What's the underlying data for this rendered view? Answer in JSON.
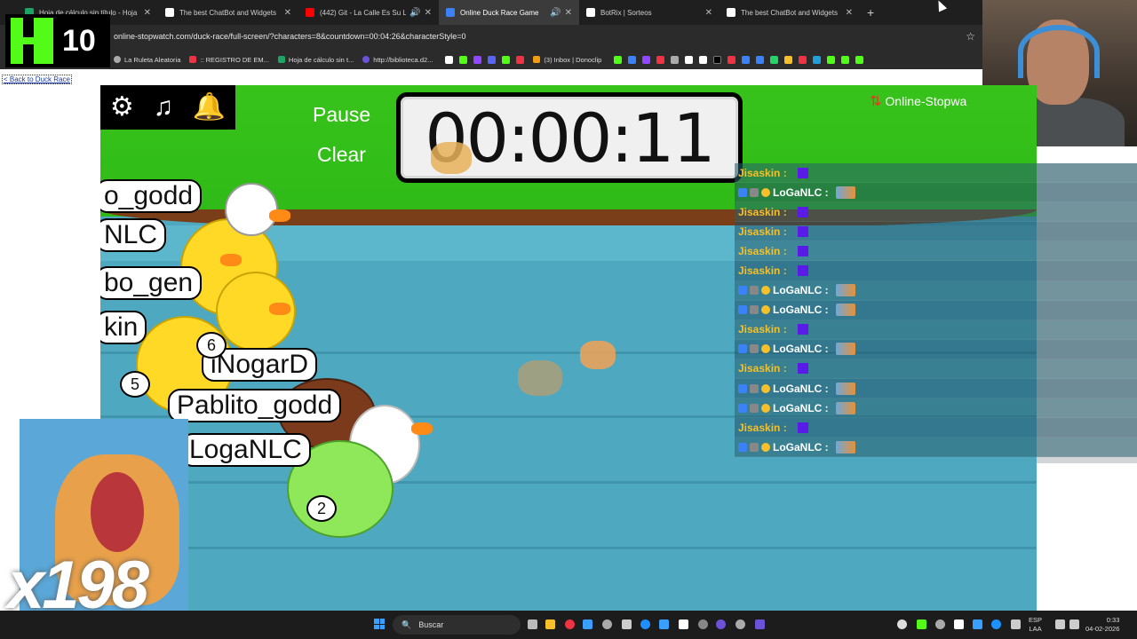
{
  "browser": {
    "tabs": [
      {
        "title": "Hoja de cálculo sin título - Hoja",
        "color": "#1ea362"
      },
      {
        "title": "The best ChatBot and Widgets",
        "color": "#ffffff"
      },
      {
        "title": "(442) Git - La Calle Es Su Lu",
        "color": "#ff0000"
      },
      {
        "title": "Online Duck Race Game",
        "color": "#3b82f6"
      },
      {
        "title": "BotRix | Sorteos",
        "color": "#ffffff"
      },
      {
        "title": "The best ChatBot and Widgets",
        "color": "#ffffff"
      }
    ],
    "active_tab": 3,
    "url": "online-stopwatch.com/duck-race/full-screen/?characters=8&countdown=00:04:26&characterStyle=0",
    "bookmarks": [
      "La Ruleta Aleatoria",
      ":: REGISTRO DE EM...",
      "Hoja de cálculo sin t...",
      "http://biblioteca.d2...",
      "(3) Inbox | Donoclip"
    ]
  },
  "overlay": {
    "kick_count": "10",
    "gift_multiplier": "x198"
  },
  "page": {
    "back_link": "< Back to Duck Race",
    "pause_label": "Pause",
    "clear_label": "Clear",
    "timer": "00:00:11",
    "brand": "Online-Stopwa"
  },
  "racers": {
    "names": [
      "o_godd",
      "NLC",
      "bo_gen",
      "kin",
      "iNogarD",
      "Pablito_godd",
      "LogaNLC"
    ],
    "numbers": [
      "5",
      "6",
      "2"
    ]
  },
  "chat": {
    "messages": [
      {
        "user": "Jisaskin :",
        "type": "j"
      },
      {
        "user": "LoGaNLC :",
        "type": "l"
      },
      {
        "user": "Jisaskin :",
        "type": "j"
      },
      {
        "user": "Jisaskin :",
        "type": "j"
      },
      {
        "user": "Jisaskin :",
        "type": "j"
      },
      {
        "user": "Jisaskin :",
        "type": "j"
      },
      {
        "user": "LoGaNLC :",
        "type": "l"
      },
      {
        "user": "LoGaNLC :",
        "type": "l"
      },
      {
        "user": "Jisaskin :",
        "type": "j"
      },
      {
        "user": "LoGaNLC :",
        "type": "l"
      },
      {
        "user": "Jisaskin :",
        "type": "j"
      },
      {
        "user": "LoGaNLC :",
        "type": "l"
      },
      {
        "user": "LoGaNLC :",
        "type": "l"
      },
      {
        "user": "Jisaskin :",
        "type": "j"
      },
      {
        "user": "LoGaNLC :",
        "type": "l"
      }
    ],
    "jisaskin_color": "#f5c02a",
    "loganlc_color": "#ffffff"
  },
  "taskbar": {
    "search_placeholder": "Buscar",
    "lang": "ESP",
    "lang_sub": "LAA",
    "time": "0:33",
    "date": "04-02-2026"
  }
}
